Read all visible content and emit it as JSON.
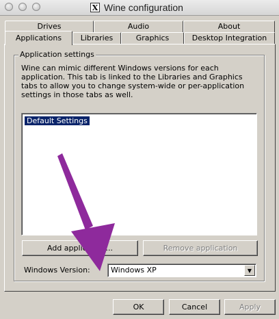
{
  "window": {
    "title": "Wine configuration",
    "logo_letter": "X"
  },
  "tabs_row1": [
    "Drives",
    "Audio",
    "About"
  ],
  "tabs_row2": [
    "Applications",
    "Libraries",
    "Graphics",
    "Desktop Integration"
  ],
  "active_tab": "Applications",
  "app_settings": {
    "group_title": "Application settings",
    "description": "Wine can mimic different Windows versions for each application. This tab is linked to the Libraries and Graphics tabs to allow you to change system-wide or per-application settings in those tabs as well.",
    "list_items": [
      "Default Settings"
    ],
    "add_button": "Add application...",
    "remove_button": "Remove application",
    "windows_version_label": "Windows Version:",
    "windows_version_value": "Windows XP",
    "dropdown_arrow": "▼"
  },
  "dialog_buttons": {
    "ok": "OK",
    "cancel": "Cancel",
    "apply": "Apply"
  },
  "colors": {
    "annotation_arrow": "#8e2a9c",
    "selection": "#0a246a",
    "face": "#d4d0c8"
  }
}
